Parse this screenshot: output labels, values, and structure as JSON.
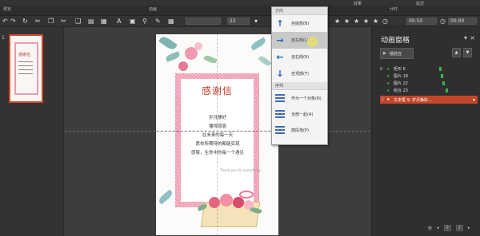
{
  "ribbon": {
    "left_group_label": "预览",
    "mid_group_label": "动画",
    "right_group_label": "计时",
    "effect_options_label": "效果",
    "delay_label": "延迟"
  },
  "qat": {
    "font_size_value": "22",
    "duration_value": "00.50",
    "delay_value": "00.00"
  },
  "slide_panel": {
    "slide_number": "1",
    "thumb_title": "感谢信"
  },
  "slide": {
    "title": "感谢信",
    "poem_lines": [
      "岁月静好",
      "懂得感恩",
      "在未来的每一天",
      "愿你所期待的都能实现",
      "感恩，生命中的每一个遇见"
    ],
    "signature": "Thank you for everything"
  },
  "direction_menu": {
    "header": "方向",
    "items": [
      {
        "label": "自底部(B)",
        "arrow": "↑"
      },
      {
        "label": "自左侧(L)",
        "arrow": "→"
      },
      {
        "label": "自右侧(R)",
        "arrow": "←"
      },
      {
        "label": "自顶部(T)",
        "arrow": "↓"
      }
    ],
    "sequence_header": "序列",
    "sequence_items": [
      {
        "label": "作为一个对象(N)"
      },
      {
        "label": "全部一起(A)"
      },
      {
        "label": "按段落(P)"
      }
    ]
  },
  "animation_pane": {
    "title": "动画窗格",
    "play_label": "播放自",
    "items": [
      {
        "index": "0",
        "name": "矩形 6"
      },
      {
        "index": "",
        "name": "图片 18"
      },
      {
        "index": "",
        "name": "图片 22"
      },
      {
        "index": "",
        "name": "组合 23"
      },
      {
        "index": "1",
        "name": "文本框 9: 岁月静好..."
      }
    ],
    "seconds_label": "秒",
    "page_value": "0",
    "page_total": "2"
  }
}
